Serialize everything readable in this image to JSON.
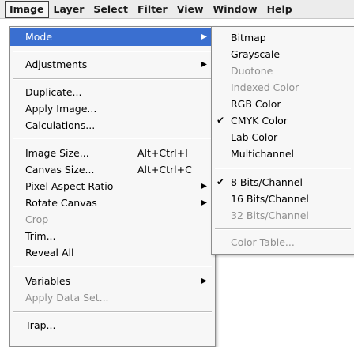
{
  "menubar": {
    "items": [
      "Image",
      "Layer",
      "Select",
      "Filter",
      "View",
      "Window",
      "Help"
    ]
  },
  "image_menu": {
    "items": [
      {
        "label": "Mode"
      },
      {
        "label": "Adjustments"
      },
      {
        "label": "Duplicate..."
      },
      {
        "label": "Apply Image..."
      },
      {
        "label": "Calculations..."
      },
      {
        "label": "Image Size...",
        "shortcut": "Alt+Ctrl+I"
      },
      {
        "label": "Canvas Size...",
        "shortcut": "Alt+Ctrl+C"
      },
      {
        "label": "Pixel Aspect Ratio"
      },
      {
        "label": "Rotate Canvas"
      },
      {
        "label": "Crop"
      },
      {
        "label": "Trim..."
      },
      {
        "label": "Reveal All"
      },
      {
        "label": "Variables"
      },
      {
        "label": "Apply Data Set..."
      },
      {
        "label": "Trap..."
      }
    ]
  },
  "mode_submenu": {
    "check_glyph": "✔",
    "items": [
      {
        "label": "Bitmap"
      },
      {
        "label": "Grayscale"
      },
      {
        "label": "Duotone"
      },
      {
        "label": "Indexed Color"
      },
      {
        "label": "RGB Color"
      },
      {
        "label": "CMYK Color"
      },
      {
        "label": "Lab Color"
      },
      {
        "label": "Multichannel"
      },
      {
        "label": "8 Bits/Channel"
      },
      {
        "label": "16 Bits/Channel"
      },
      {
        "label": "32 Bits/Channel"
      },
      {
        "label": "Color Table..."
      }
    ]
  },
  "colors": {
    "highlight": "#3a6fd0",
    "disabled_text": "#8f8f8f",
    "menu_bg": "#f7f7f7"
  }
}
